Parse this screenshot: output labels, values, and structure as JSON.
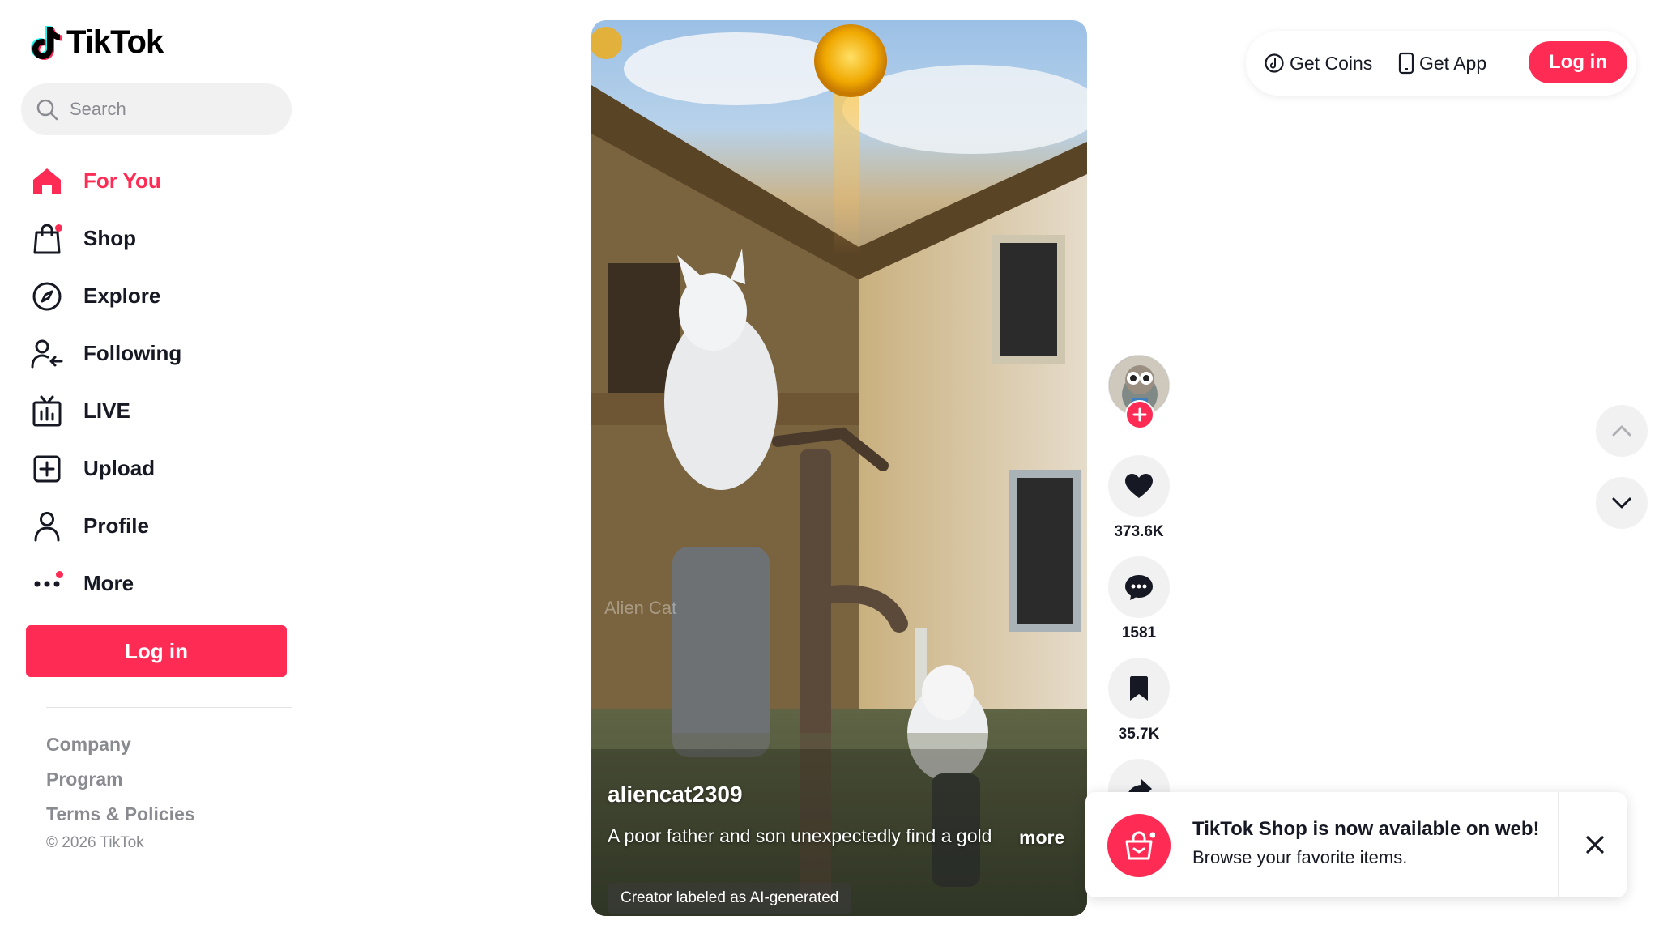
{
  "brand": {
    "name": "TikTok",
    "accent": "#fe2c55"
  },
  "search": {
    "placeholder": "Search",
    "icon": "search-icon"
  },
  "nav": {
    "items": [
      {
        "label": "For You",
        "icon": "home-icon",
        "active": true
      },
      {
        "label": "Shop",
        "icon": "shopping-bag-icon",
        "badge": true
      },
      {
        "label": "Explore",
        "icon": "compass-icon"
      },
      {
        "label": "Following",
        "icon": "user-follow-icon"
      },
      {
        "label": "LIVE",
        "icon": "live-tv-icon"
      },
      {
        "label": "Upload",
        "icon": "plus-square-icon"
      },
      {
        "label": "Profile",
        "icon": "user-icon"
      },
      {
        "label": "More",
        "icon": "more-dots-icon",
        "badge": true
      }
    ]
  },
  "sidebar": {
    "login_label": "Log in"
  },
  "footer": {
    "links": [
      "Company",
      "Program",
      "Terms & Policies"
    ],
    "copyright": "© 2026 TikTok"
  },
  "video": {
    "watermark": "Alien Cat",
    "author": "aliencat2309",
    "caption": "A poor father and son unexpectedly find a gold",
    "more_label": "more",
    "ai_label": "Creator labeled as AI-generated"
  },
  "actions": {
    "likes": "373.6K",
    "comments": "1581",
    "saves": "35.7K"
  },
  "topbar": {
    "get_coins": "Get Coins",
    "get_app": "Get App",
    "login": "Log in"
  },
  "toast": {
    "title": "TikTok Shop is now available on web!",
    "subtitle": "Browse your favorite items."
  }
}
